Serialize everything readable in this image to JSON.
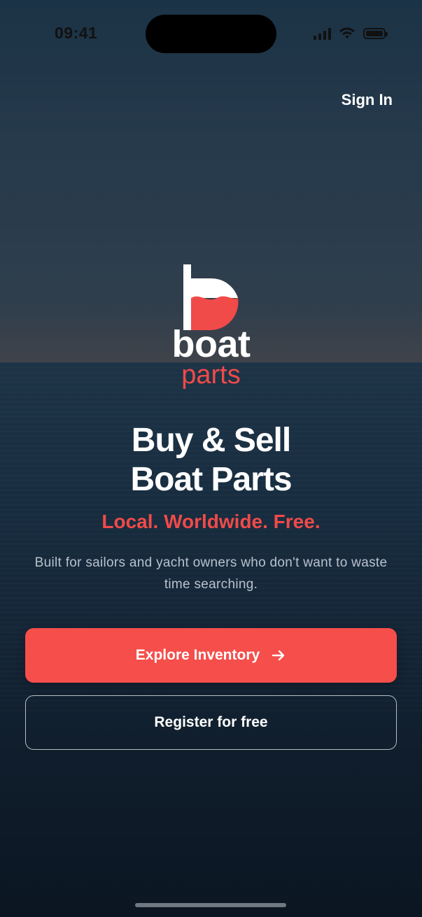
{
  "status_bar": {
    "time": "09:41",
    "icons": [
      "cellular-signal-icon",
      "wifi-icon",
      "battery-icon"
    ]
  },
  "header": {
    "sign_in_label": "Sign In"
  },
  "logo": {
    "word": "boat",
    "sub": "parts",
    "icon": "boat-flag-logo-icon",
    "colors": {
      "primary": "#ffffff",
      "accent": "#f04a49"
    }
  },
  "hero": {
    "headline_line1": "Buy & Sell",
    "headline_line2": "Boat Parts",
    "tagline": "Local. Worldwide. Free.",
    "description": "Built for sailors and yacht owners who don't want to waste time searching."
  },
  "actions": {
    "primary_label": "Explore Inventory",
    "primary_icon": "arrow-right-icon",
    "secondary_label": "Register for free"
  },
  "colors": {
    "accent": "#f54e4b",
    "text": "#ffffff",
    "muted_text": "#b9c2cc"
  }
}
